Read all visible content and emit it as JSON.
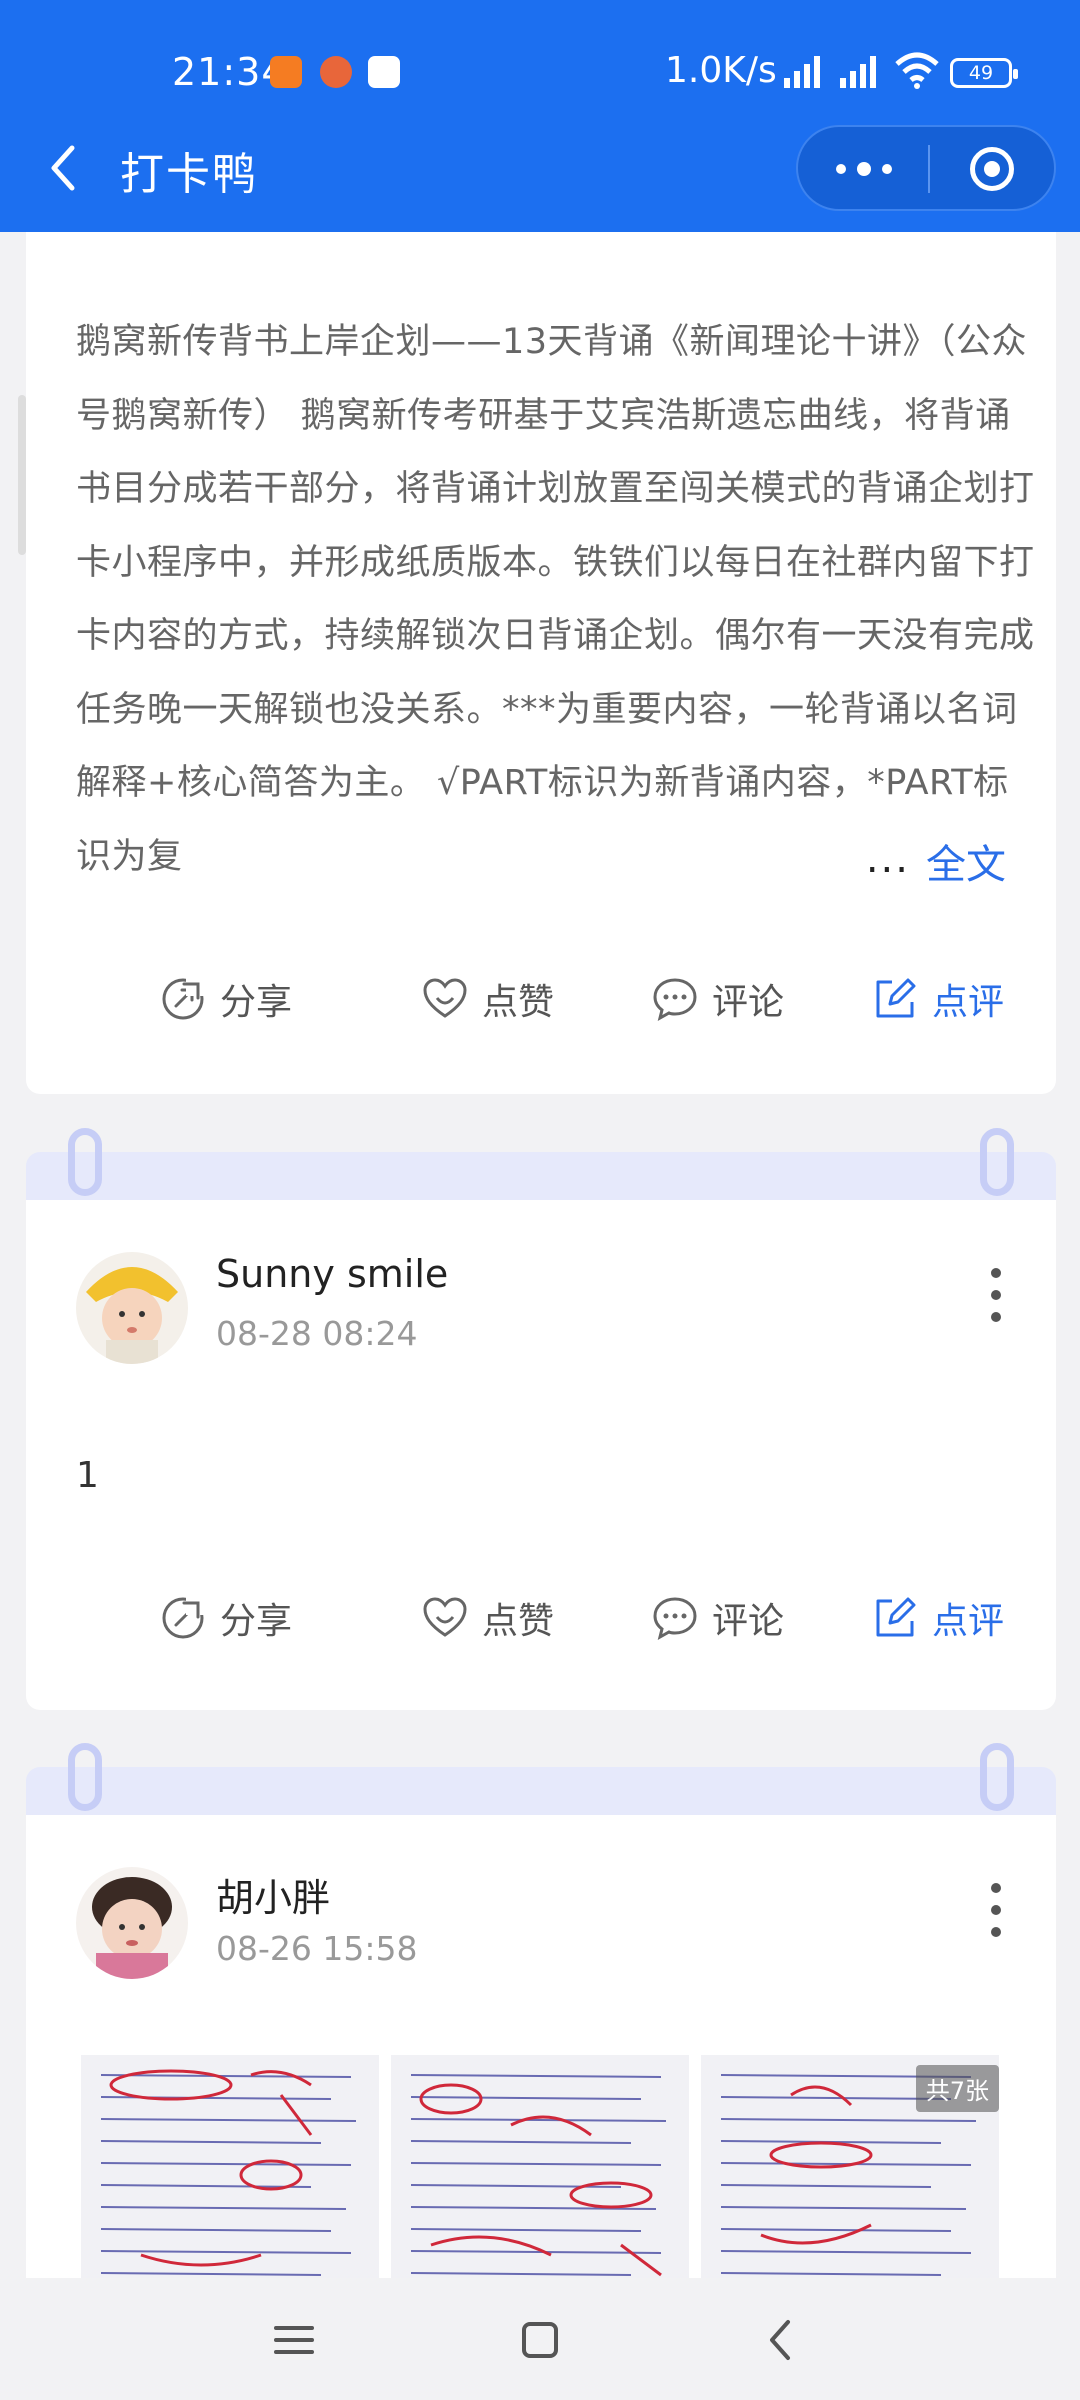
{
  "status_bar": {
    "time": "21:34",
    "net_speed": "1.0K/s",
    "battery": "49"
  },
  "title_bar": {
    "title": "打卡鸭"
  },
  "card1": {
    "text": "鹅窝新传背书上岸企划——13天背诵《新闻理论十讲》（公众号鹅窝新传） 鹅窝新传考研基于艾宾浩斯遗忘曲线，将背诵书目分成若干部分，将背诵计划放置至闯关模式的背诵企划打卡小程序中，并形成纸质版本。铁铁们以每日在社群内留下打卡内容的方式，持续解锁次日背诵企划。偶尔有一天没有完成任务晚一天解锁也没关系。***为重要内容，一轮背诵以名词解释+核心简答为主。 √PART标识为新背诵内容，*PART标识为复",
    "ellipsis": "...",
    "more": "全文"
  },
  "actions": {
    "share": "分享",
    "like": "点赞",
    "comment": "评论",
    "review": "点评"
  },
  "posts": [
    {
      "username": "Sunny smile",
      "date": "08-28 08:24",
      "text": "1"
    },
    {
      "username": "胡小胖",
      "date": "08-26 15:58",
      "image_count": "共7张"
    }
  ],
  "colors": {
    "brand_blue": "#1c6ff0",
    "link_blue": "#2a6ee8",
    "strip_lavender": "#e6e9fb"
  },
  "icons": [
    "back-icon",
    "more-icon",
    "close-icon",
    "share-icon",
    "like-icon",
    "comment-icon",
    "review-icon",
    "menu-icon",
    "home-icon"
  ]
}
